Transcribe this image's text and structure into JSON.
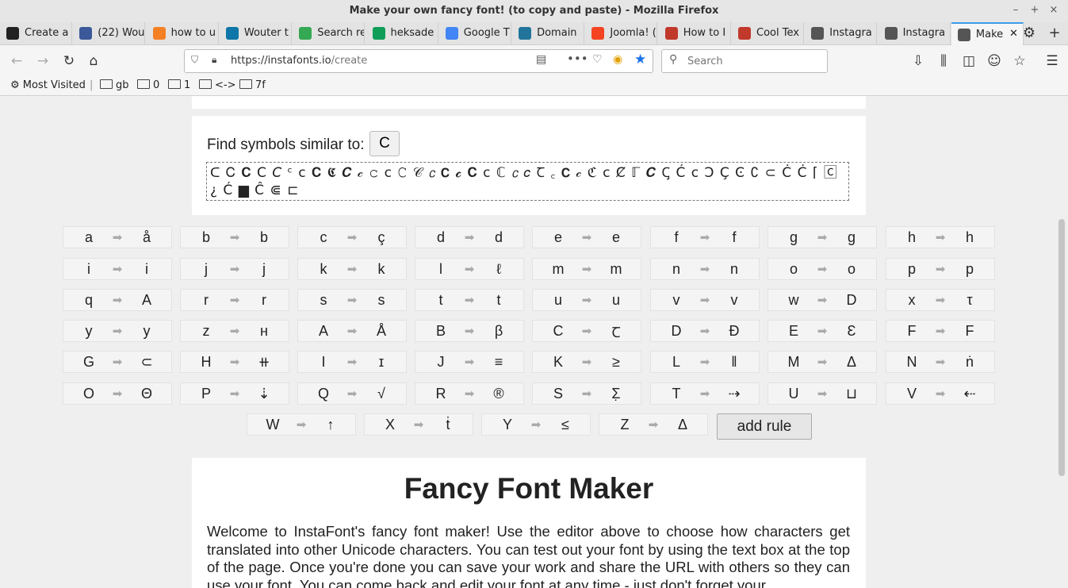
{
  "window": {
    "title": "Make your own fancy font! (to copy and paste) - Mozilla Firefox",
    "controls": [
      "–",
      "+",
      "×"
    ]
  },
  "tabs": [
    {
      "label": "Create a",
      "icon": "github-icon",
      "color": "#222222"
    },
    {
      "label": "(22) Wou",
      "icon": "facebook-icon",
      "color": "#3b5998"
    },
    {
      "label": "how to u",
      "icon": "stackoverflow-icon",
      "color": "#f48024"
    },
    {
      "label": "Wouter t",
      "icon": "linkedin-icon",
      "color": "#0e76a8"
    },
    {
      "label": "Search re",
      "icon": "drive-icon",
      "color": "#34a853"
    },
    {
      "label": "heksade",
      "icon": "sheets-icon",
      "color": "#0f9d58"
    },
    {
      "label": "Google T",
      "icon": "translate-icon",
      "color": "#4285f4"
    },
    {
      "label": "Domain",
      "icon": "wordpress-icon",
      "color": "#21759b"
    },
    {
      "label": "Joomla! (",
      "icon": "joomla-icon",
      "color": "#f44321"
    },
    {
      "label": "How to I",
      "icon": "howto-icon",
      "color": "#c0392b"
    },
    {
      "label": "Cool Tex",
      "icon": "cooltext-icon",
      "color": "#c0392b"
    },
    {
      "label": "Instagra",
      "icon": "instafonts-icon",
      "color": "#555555"
    },
    {
      "label": "Instagra",
      "icon": "instafonts-icon",
      "color": "#555555"
    },
    {
      "label": "Make",
      "icon": "instafonts-icon",
      "color": "#555555",
      "active": true
    }
  ],
  "nav": {
    "url_host": "https://instafonts.io",
    "url_path": "/create",
    "search_placeholder": "Search"
  },
  "bookmarks": {
    "most_visited": "Most Visited",
    "folders": [
      "gb",
      "0",
      "1",
      "<->",
      "7f"
    ]
  },
  "similar": {
    "label": "Find symbols similar to:",
    "char": "C",
    "symbols": "ᑕ Ꮯ 𝐂 𝖢 𝘊 ᶜ ᴄ 𝐂 𝕮 𝑪 𝒸 𝚌 𝖼 𝙲 𝒞 𝘤 𝗖 𝓬 𝐂 𝖼 ℂ 𝘤 𝑐 Ꞇ ꜀ 𝗖 𝒸 ℭ ⅽ Ȼ ℾ 𝑪 Ꞔ Ć ⅽ Ͻ Ç Ͼ ∁ ⊂ Ċ Ċ ⌈ 🄲 ¿ Ć ▆ Ĉ ⋐ ⊏"
  },
  "rules": [
    [
      "a",
      "å"
    ],
    [
      "b",
      "b"
    ],
    [
      "c",
      "ç"
    ],
    [
      "d",
      "d"
    ],
    [
      "e",
      "e"
    ],
    [
      "f",
      "f"
    ],
    [
      "g",
      "g"
    ],
    [
      "h",
      "h"
    ],
    [
      "i",
      "i"
    ],
    [
      "j",
      "j"
    ],
    [
      "k",
      "k"
    ],
    [
      "l",
      "ℓ"
    ],
    [
      "m",
      "m"
    ],
    [
      "n",
      "n"
    ],
    [
      "o",
      "o"
    ],
    [
      "p",
      "p"
    ],
    [
      "q",
      "A"
    ],
    [
      "r",
      "r"
    ],
    [
      "s",
      "s"
    ],
    [
      "t",
      "t"
    ],
    [
      "u",
      "u"
    ],
    [
      "v",
      "v"
    ],
    [
      "w",
      "D"
    ],
    [
      "x",
      "τ"
    ],
    [
      "y",
      "y"
    ],
    [
      "z",
      "н"
    ],
    [
      "A",
      "Å"
    ],
    [
      "B",
      "β"
    ],
    [
      "C",
      "Ꞇ"
    ],
    [
      "D",
      "Ɖ"
    ],
    [
      "E",
      "Ɛ"
    ],
    [
      "F",
      "F"
    ],
    [
      "G",
      "⊂"
    ],
    [
      "H",
      "⧺"
    ],
    [
      "I",
      "ɪ"
    ],
    [
      "J",
      "≡"
    ],
    [
      "K",
      "≥"
    ],
    [
      "L",
      "‖"
    ],
    [
      "M",
      "Δ"
    ],
    [
      "N",
      "ṅ"
    ],
    [
      "O",
      "Θ"
    ],
    [
      "P",
      "⇣"
    ],
    [
      "Q",
      "√"
    ],
    [
      "R",
      "®"
    ],
    [
      "S",
      "Σ̣"
    ],
    [
      "T",
      "⇢"
    ],
    [
      "U",
      "⊔"
    ],
    [
      "V",
      "⇠"
    ],
    [
      "W",
      "↑"
    ],
    [
      "X",
      "ṫ"
    ],
    [
      "Y",
      "≤"
    ],
    [
      "Z",
      "Δ"
    ]
  ],
  "add_rule_label": "add rule",
  "info": {
    "title": "Fancy Font Maker",
    "body": "Welcome to InstaFont's fancy font maker! Use the editor above to choose how characters get translated into other Unicode characters. You can test out your font by using the text box at the top of the page. Once you're done you can save your work and share the URL with others so they can use your font. You can come back and edit your font at any time - just don't forget your"
  }
}
